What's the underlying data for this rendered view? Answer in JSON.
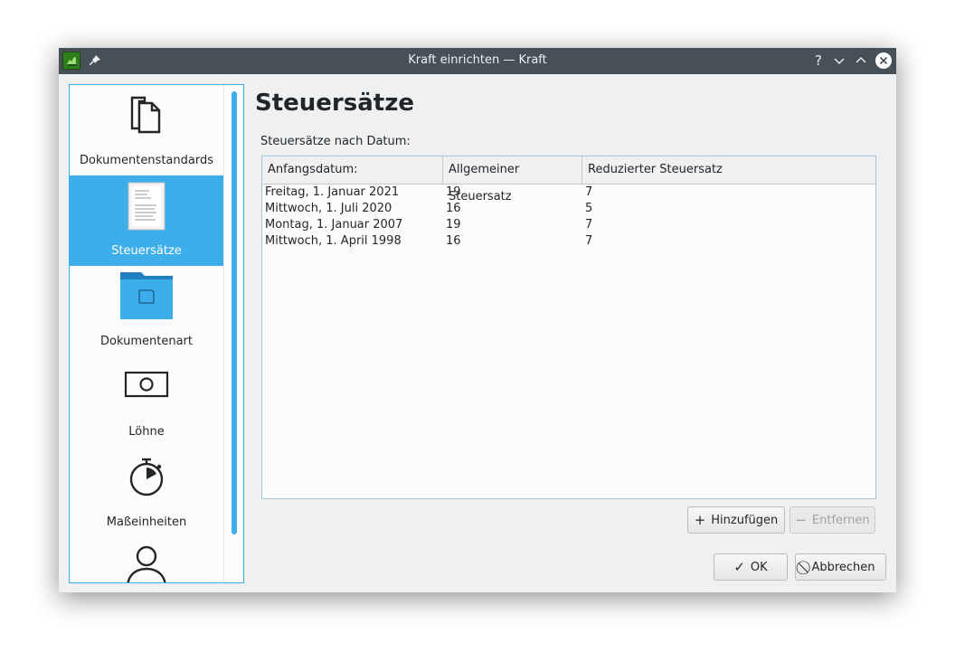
{
  "window": {
    "title": "Kraft einrichten — Kraft"
  },
  "titlebar": {
    "help_glyph": "?",
    "minimize_glyph": "⌄",
    "maximize_glyph": "⌃"
  },
  "sidebar": {
    "items": [
      {
        "label": "Dokumentenstandards",
        "icon": "documents-icon",
        "active": false
      },
      {
        "label": "Steuersätze",
        "icon": "tax-document-icon",
        "active": true
      },
      {
        "label": "Dokumentenart",
        "icon": "folder-icon",
        "active": false
      },
      {
        "label": "Löhne",
        "icon": "money-icon",
        "active": false
      },
      {
        "label": "Maßeinheiten",
        "icon": "stopwatch-icon",
        "active": false
      },
      {
        "label": "",
        "icon": "user-icon",
        "active": false
      }
    ]
  },
  "page": {
    "title": "Steuersätze",
    "caption": "Steuersätze nach Datum:"
  },
  "table": {
    "columns": [
      "Anfangsdatum:",
      "Allgemeiner Steuersatz",
      "Reduzierter Steuersatz"
    ],
    "rows": [
      [
        "Freitag, 1. Januar 2021",
        "19",
        "7"
      ],
      [
        "Mittwoch, 1. Juli 2020",
        "16",
        "5"
      ],
      [
        "Montag, 1. Januar 2007",
        "19",
        "7"
      ],
      [
        "Mittwoch, 1. April 1998",
        "16",
        "7"
      ]
    ]
  },
  "buttons": {
    "add_label": "Hinzufügen",
    "remove_label": "Entfernen",
    "ok_label": "OK",
    "cancel_label": "Abbrechen"
  },
  "colors": {
    "accent": "#3daee9",
    "titlebar": "#475057",
    "background": "#eff0f1"
  }
}
